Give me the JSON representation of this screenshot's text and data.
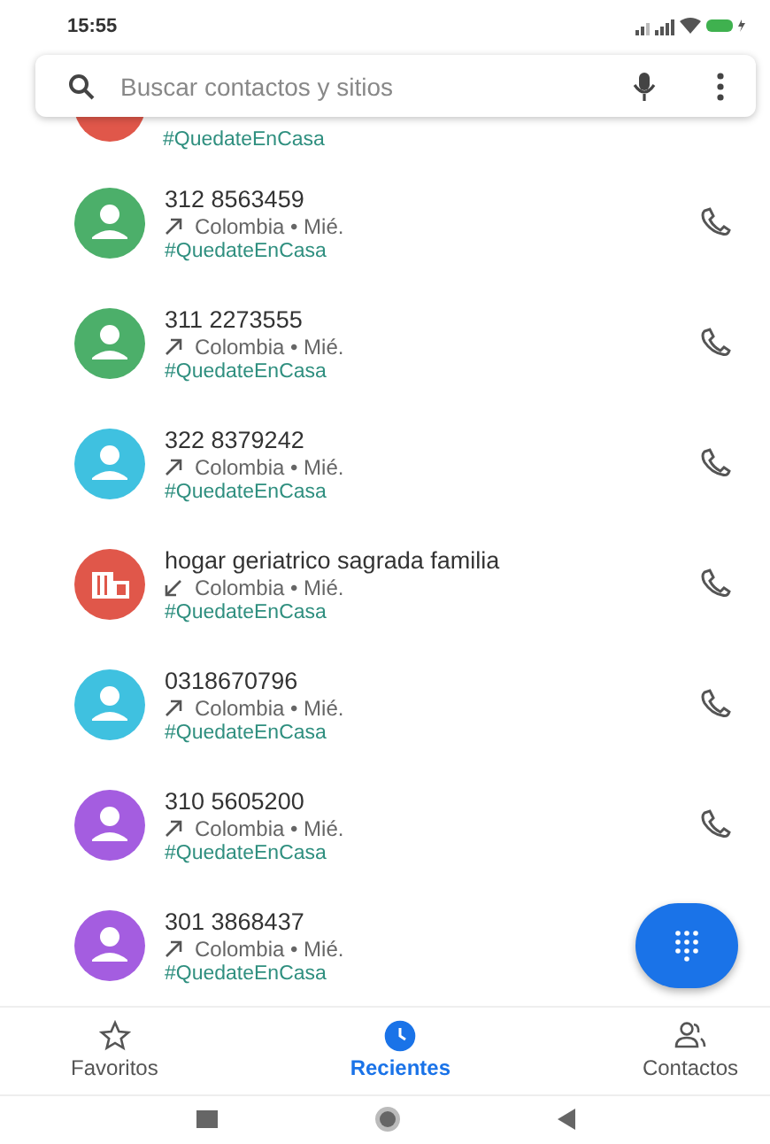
{
  "status_bar": {
    "time": "15:55"
  },
  "search": {
    "placeholder": "Buscar contactos y sitios"
  },
  "partial_row": {
    "tag": "#QuedateEnCasa",
    "color": "#e0574a"
  },
  "calls": [
    {
      "name": "312 8563459",
      "incoming": false,
      "detail": "Colombia • Mié.",
      "tag": "#QuedateEnCasa",
      "kind": "person",
      "color": "#4caf6a"
    },
    {
      "name": "311 2273555",
      "incoming": false,
      "detail": "Colombia • Mié.",
      "tag": "#QuedateEnCasa",
      "kind": "person",
      "color": "#4caf6a"
    },
    {
      "name": "322 8379242",
      "incoming": false,
      "detail": "Colombia • Mié.",
      "tag": "#QuedateEnCasa",
      "kind": "person",
      "color": "#3fc1e0"
    },
    {
      "name": "hogar geriatrico sagrada familia",
      "incoming": true,
      "detail": "Colombia • Mié.",
      "tag": "#QuedateEnCasa",
      "kind": "business",
      "color": "#e0574a"
    },
    {
      "name": "0318670796",
      "incoming": false,
      "detail": "Colombia • Mié.",
      "tag": "#QuedateEnCasa",
      "kind": "person",
      "color": "#3fc1e0"
    },
    {
      "name": "310 5605200",
      "incoming": false,
      "detail": "Colombia • Mié.",
      "tag": "#QuedateEnCasa",
      "kind": "person",
      "color": "#a45de0"
    },
    {
      "name": "301 3868437",
      "incoming": false,
      "detail": "Colombia • Mié.",
      "tag": "#QuedateEnCasa",
      "kind": "person",
      "color": "#a45de0"
    }
  ],
  "bottom_nav": [
    {
      "label": "Favoritos",
      "selected": false
    },
    {
      "label": "Recientes",
      "selected": true
    },
    {
      "label": "Contactos",
      "selected": false
    }
  ]
}
